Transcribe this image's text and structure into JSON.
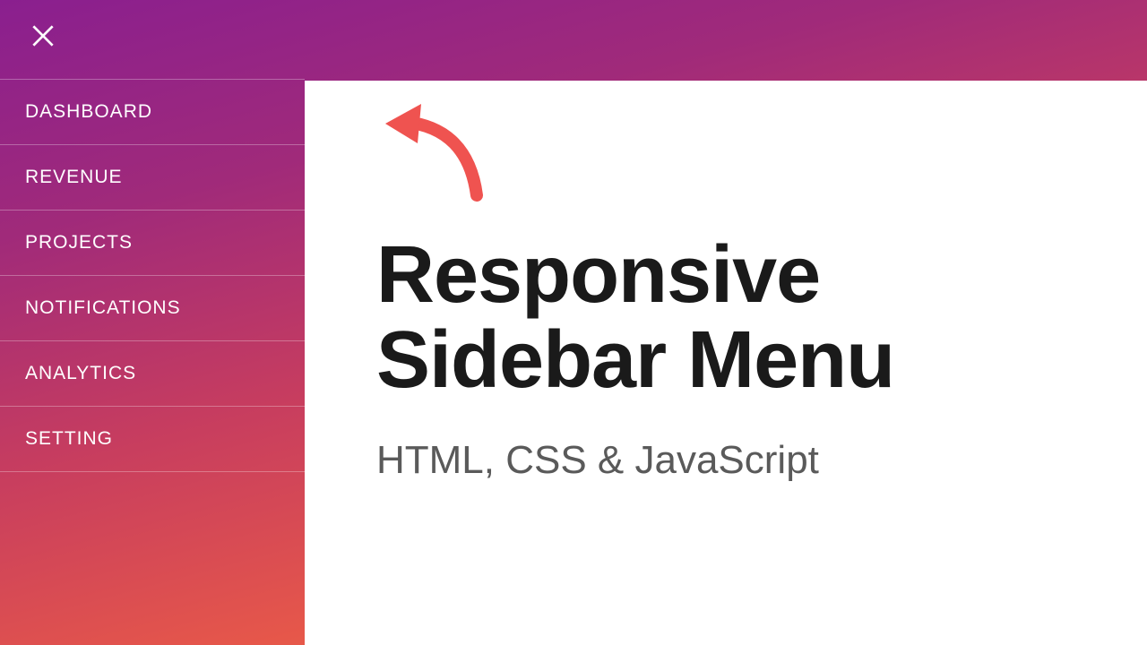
{
  "sidebar": {
    "items": [
      {
        "label": "DASHBOARD"
      },
      {
        "label": "REVENUE"
      },
      {
        "label": "PROJECTS"
      },
      {
        "label": "NOTIFICATIONS"
      },
      {
        "label": "ANALYTICS"
      },
      {
        "label": "SETTING"
      }
    ]
  },
  "main": {
    "title_line1": "Responsive",
    "title_line2": "Sidebar Menu",
    "subtitle": "HTML, CSS & JavaScript"
  },
  "colors": {
    "arrow": "#ef5350",
    "text_dark": "#1a1a1a",
    "text_muted": "#5a5a5a"
  }
}
